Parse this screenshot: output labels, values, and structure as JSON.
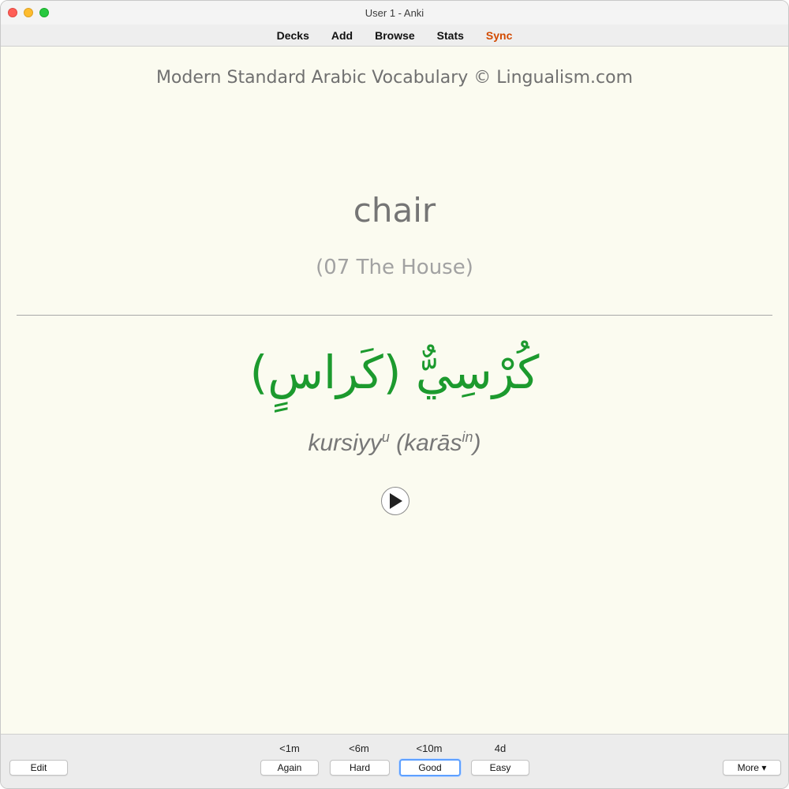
{
  "window": {
    "title": "User 1 - Anki"
  },
  "menu": {
    "decks": "Decks",
    "add": "Add",
    "browse": "Browse",
    "stats": "Stats",
    "sync": "Sync"
  },
  "card": {
    "deck_title": "Modern Standard Arabic Vocabulary © Lingualism.com",
    "front_word": "chair",
    "category": "(07 The House)",
    "arabic": "كُرْسِيٌّ (كَراسٍ)",
    "translit_main": "kursiyy",
    "translit_main_sup": "u",
    "translit_plural": "karās",
    "translit_plural_sup": "in",
    "play_icon": "play-icon"
  },
  "bottom": {
    "edit_label": "Edit",
    "more_label": "More ▾",
    "answers": [
      {
        "interval": "<1m",
        "label": "Again"
      },
      {
        "interval": "<6m",
        "label": "Hard"
      },
      {
        "interval": "<10m",
        "label": "Good"
      },
      {
        "interval": "4d",
        "label": "Easy"
      }
    ]
  },
  "colors": {
    "card_background": "#fbfbf0",
    "arabic_text": "#1c9a2e",
    "sync_link": "#d24a00",
    "focus_ring": "#5ea0ff"
  }
}
